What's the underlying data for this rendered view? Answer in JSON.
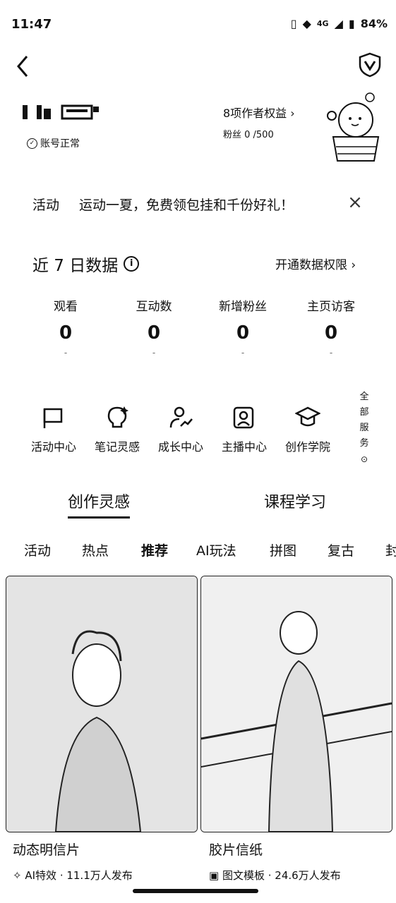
{
  "status_bar": {
    "time": "11:47",
    "network": "4G",
    "battery": "84%"
  },
  "profile": {
    "account_status": "账号正常",
    "rights": "8项作者权益",
    "fans": "粉丝 0 /500"
  },
  "banner": {
    "tag": "活动",
    "text": "运动一夏，免费领包挂和千份好礼！"
  },
  "data_section": {
    "title": "近 7 日数据",
    "link": "开通数据权限",
    "stats": [
      {
        "label": "观看",
        "value": "0",
        "dash": "-"
      },
      {
        "label": "互动数",
        "value": "0",
        "dash": "-"
      },
      {
        "label": "新增粉丝",
        "value": "0",
        "dash": "-"
      },
      {
        "label": "主页访客",
        "value": "0",
        "dash": "-"
      }
    ]
  },
  "services": [
    {
      "label": "活动中心",
      "icon": "flag-icon"
    },
    {
      "label": "笔记灵感",
      "icon": "bulb-icon"
    },
    {
      "label": "成长中心",
      "icon": "growth-icon"
    },
    {
      "label": "主播中心",
      "icon": "anchor-icon"
    },
    {
      "label": "创作学院",
      "icon": "graduation-cap-icon"
    }
  ],
  "all_services": {
    "chars": [
      "全",
      "部",
      "服",
      "务"
    ]
  },
  "main_tabs": [
    "创作灵感",
    "课程学习"
  ],
  "categories": [
    "活动",
    "热点",
    "推荐",
    "AI玩法",
    "拼图",
    "复古",
    "封"
  ],
  "cards": [
    {
      "title": "动态明信片",
      "meta": "AI特效 · 11.1万人发布",
      "meta_icon": "sparkle-icon"
    },
    {
      "title": "胶片信纸",
      "meta": "图文模板 · 24.6万人发布",
      "meta_icon": "template-icon"
    }
  ]
}
